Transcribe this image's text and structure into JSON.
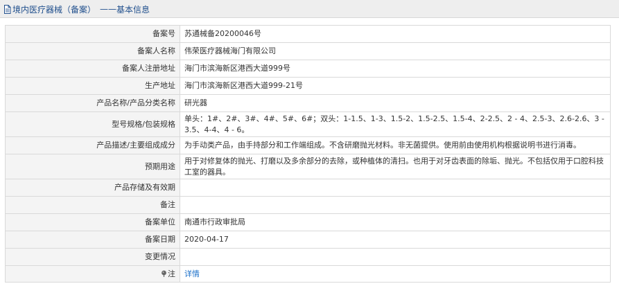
{
  "header": {
    "title": "境内医疗器械（备案）",
    "separator": "——",
    "subtitle": "基本信息",
    "icon": "document-icon"
  },
  "rows": [
    {
      "label": "备案号",
      "value": "苏通械备20200046号"
    },
    {
      "label": "备案人名称",
      "value": "伟荣医疗器械海门有限公司"
    },
    {
      "label": "备案人注册地址",
      "value": "海门市滨海新区港西大道999号"
    },
    {
      "label": "生产地址",
      "value": "海门市滨海新区港西大道999-21号"
    },
    {
      "label": "产品名称/产品分类名称",
      "value": "研光器"
    },
    {
      "label": "型号规格/包装规格",
      "value": "单头：1#、2#、3#、4#、5#、6#；双头：1-1.5、1-3、1.5-2、1.5-2.5、1.5-4、2-2.5、2 - 4、2.5-3、2.6-2.6、3 - 3.5、4-4、4 - 6。"
    },
    {
      "label": "产品描述/主要组成成分",
      "value": "为手动类产品，由手持部分和工作端组成。不含研磨抛光材料。非无菌提供。使用前由使用机构根据说明书进行消毒。"
    },
    {
      "label": "预期用途",
      "value": "用于对修复体的抛光、打磨以及多余部分的去除，或种植体的清扫。也用于对牙齿表面的除垢、抛光。不包括仅用于口腔科技工室的器具。"
    },
    {
      "label": "产品存储及有效期",
      "value": ""
    },
    {
      "label": "备注",
      "value": ""
    },
    {
      "label": "备案单位",
      "value": "南通市行政审批局"
    },
    {
      "label": "备案日期",
      "value": "2020-04-17"
    },
    {
      "label": "变更情况",
      "value": ""
    }
  ],
  "note_row": {
    "label": "注",
    "icon": "pin-icon",
    "link_text": "详情"
  },
  "colors": {
    "title_text": "#1f4e8c",
    "link": "#1a6fc9",
    "label_bg": "#f4f4f4",
    "border": "#d9d9d9",
    "header_bg": "#eeeeee"
  }
}
